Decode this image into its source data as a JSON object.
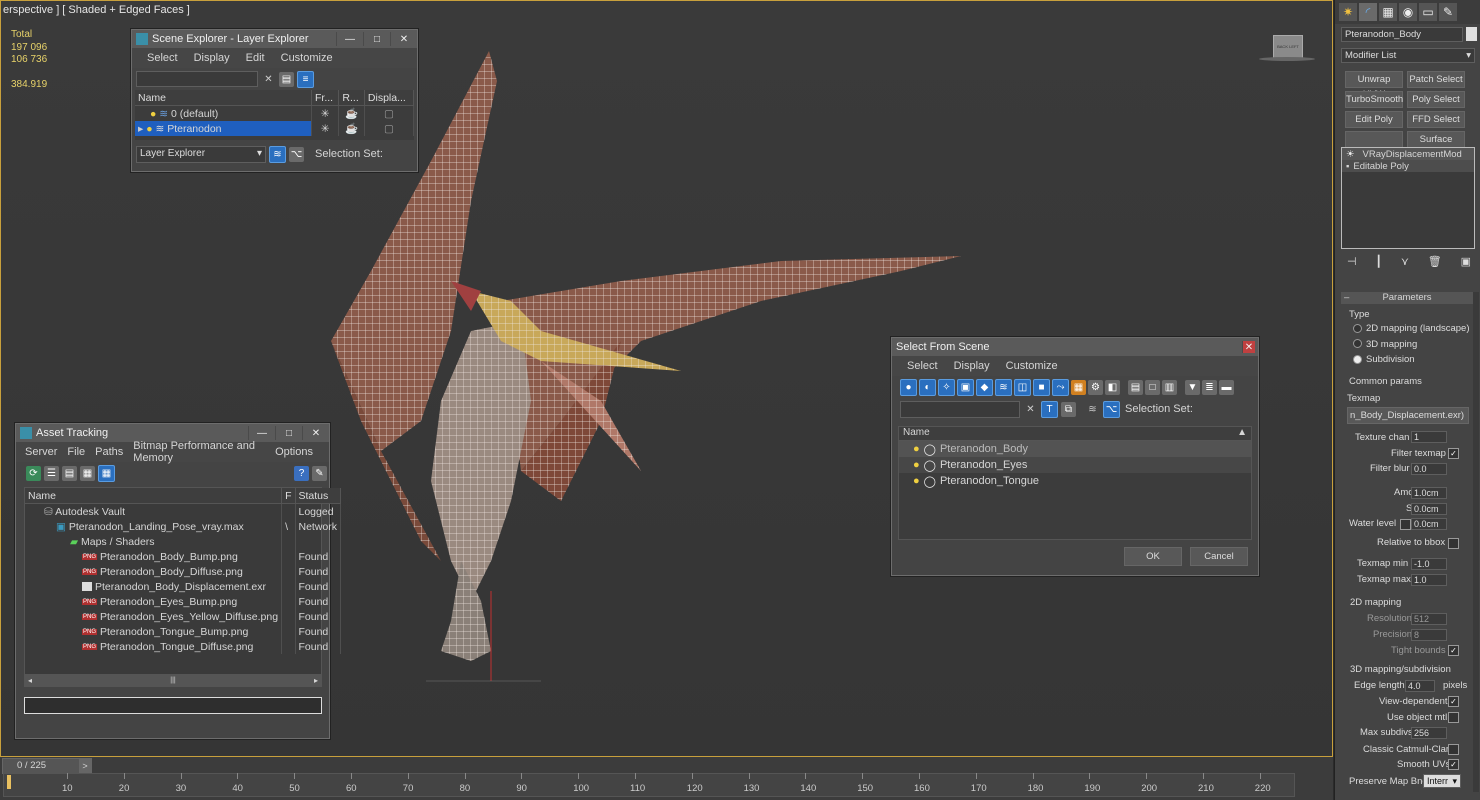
{
  "viewport": {
    "label": "erspective ] [ Shaded + Edged Faces ]",
    "stats": {
      "label": "Total",
      "polys": "197 096",
      "verts": "106 736",
      "fps": "384.919"
    },
    "cube_label": "BACK LEFT"
  },
  "scene_explorer": {
    "title": "Scene Explorer - Layer Explorer",
    "menu": [
      "Select",
      "Display",
      "Edit",
      "Customize"
    ],
    "columns": [
      "Name",
      "Fr...",
      "R...",
      "Displa..."
    ],
    "rows": [
      {
        "name": "0 (default)",
        "selected": false
      },
      {
        "name": "Pteranodon",
        "selected": true
      }
    ],
    "footer_dropdown": "Layer Explorer",
    "selection_set_label": "Selection Set:"
  },
  "asset_tracking": {
    "title": "Asset Tracking",
    "menu": [
      "Server",
      "File",
      "Paths",
      "Bitmap Performance and Memory",
      "Options"
    ],
    "columns": [
      "Name",
      "F",
      "Status"
    ],
    "rows": [
      {
        "name": "Autodesk Vault",
        "flag": "",
        "status": "Logged"
      },
      {
        "name": "Pteranodon_Landing_Pose_vray.max",
        "flag": "\\",
        "status": "Network"
      },
      {
        "name": "Maps / Shaders",
        "flag": "",
        "status": ""
      },
      {
        "name": "Pteranodon_Body_Bump.png",
        "flag": "",
        "status": "Found"
      },
      {
        "name": "Pteranodon_Body_Diffuse.png",
        "flag": "",
        "status": "Found"
      },
      {
        "name": "Pteranodon_Body_Displacement.exr",
        "flag": "",
        "status": "Found"
      },
      {
        "name": "Pteranodon_Eyes_Bump.png",
        "flag": "",
        "status": "Found"
      },
      {
        "name": "Pteranodon_Eyes_Yellow_Diffuse.png",
        "flag": "",
        "status": "Found"
      },
      {
        "name": "Pteranodon_Tongue_Bump.png",
        "flag": "",
        "status": "Found"
      },
      {
        "name": "Pteranodon_Tongue_Diffuse.png",
        "flag": "",
        "status": "Found"
      }
    ],
    "png_badge": "PNG"
  },
  "select_from_scene": {
    "title": "Select From Scene",
    "menu": [
      "Select",
      "Display",
      "Customize"
    ],
    "selection_set_label": "Selection Set:",
    "column": "Name",
    "items": [
      "Pteranodon_Body",
      "Pteranodon_Eyes",
      "Pteranodon_Tongue"
    ],
    "ok": "OK",
    "cancel": "Cancel"
  },
  "command_panel": {
    "object_name": "Pteranodon_Body",
    "modifier_list": "Modifier List",
    "mod_buttons": [
      "Unwrap UVW",
      "Patch Select",
      "TurboSmooth",
      "Poly Select",
      "Edit Poly",
      "FFD Select",
      "",
      "Surface Select"
    ],
    "stack": [
      "VRayDisplacementMod",
      "Editable Poly"
    ],
    "rollout": "Parameters",
    "type_label": "Type",
    "type_options": [
      "2D mapping (landscape)",
      "3D mapping",
      "Subdivision"
    ],
    "type_selected": 2,
    "common_params": "Common params",
    "texmap_label": "Texmap",
    "texmap_value": "n_Body_Displacement.exr)",
    "texture_chan_label": "Texture chan",
    "texture_chan": "1",
    "filter_texmap_label": "Filter texmap",
    "filter_blur_label": "Filter blur",
    "filter_blur": "0.0",
    "amount_label": "Amount",
    "amount": "1.0cm",
    "shift_label": "Shift",
    "shift": "0.0cm",
    "water_level_label": "Water level",
    "water_level": "0.0cm",
    "relative_bbox_label": "Relative to bbox",
    "texmap_min_label": "Texmap min",
    "texmap_min": "-1.0",
    "texmap_max_label": "Texmap max",
    "texmap_max": "1.0",
    "mapping2d": "2D mapping",
    "resolution_label": "Resolution",
    "resolution": "512",
    "precision_label": "Precision",
    "precision": "8",
    "tight_bounds_label": "Tight bounds",
    "mapping3d": "3D mapping/subdivision",
    "edge_length_label": "Edge length",
    "edge_length": "4.0",
    "pixels_label": "pixels",
    "view_dependent_label": "View-dependent",
    "use_object_mtl_label": "Use object mtl",
    "max_subdivs_label": "Max subdivs",
    "max_subdivs": "256",
    "catmull_label": "Classic Catmull-Clark",
    "smooth_uvs_label": "Smooth UVs",
    "preserve_label": "Preserve Map Bnd",
    "preserve_value": "Interr"
  },
  "timeline": {
    "frame": "0 / 225",
    "next": ">",
    "ticks": [
      "10",
      "20",
      "30",
      "40",
      "50",
      "60",
      "70",
      "80",
      "90",
      "100",
      "110",
      "120",
      "130",
      "140",
      "150",
      "160",
      "170",
      "180",
      "190",
      "200",
      "210",
      "220"
    ]
  },
  "colors": {
    "selected_row": "#1f5fbf",
    "viewport_border": "#c8a03c",
    "accent_blue": "#2a6fbf"
  }
}
